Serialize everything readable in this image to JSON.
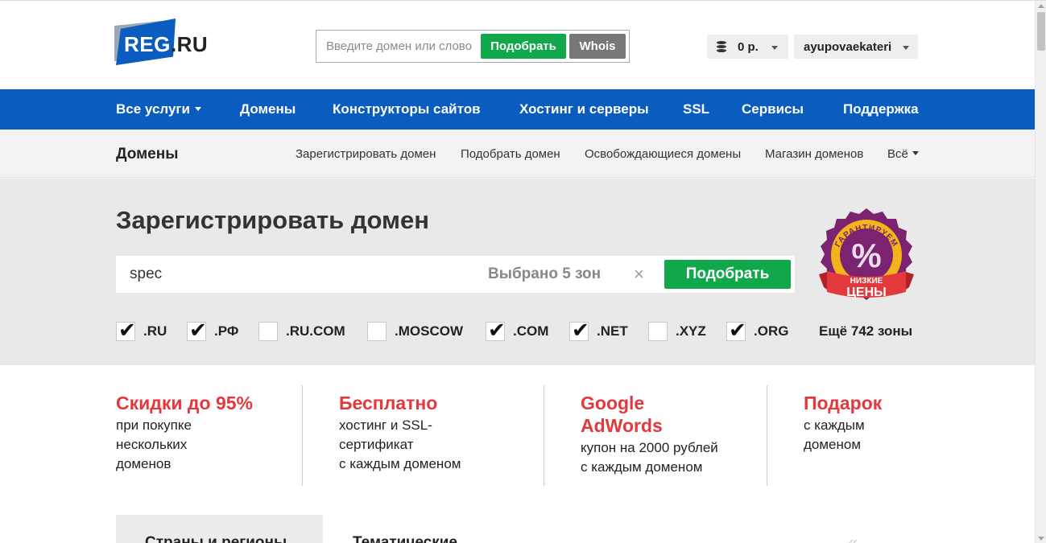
{
  "header": {
    "logo_text": "REG",
    "logo_suffix": ".RU",
    "search_placeholder": "Введите домен или слово",
    "pick_button": "Подобрать",
    "whois_button": "Whois",
    "balance": "0 р.",
    "account_name": "ayupovaekaterina"
  },
  "mainnav": {
    "items": [
      "Все услуги",
      "Домены",
      "Конструкторы сайтов",
      "Хостинг и серверы",
      "SSL",
      "Сервисы",
      "Поддержка"
    ]
  },
  "subnav": {
    "title": "Домены",
    "links": [
      "Зарегистрировать домен",
      "Подобрать домен",
      "Освобождающиеся домены",
      "Магазин доменов",
      "Всё"
    ]
  },
  "hero": {
    "title": "Зарегистрировать домен",
    "input_value": "spec",
    "selected_zones": "Выбрано 5 зон",
    "clear": "×",
    "pick_button": "Подобрать",
    "zones": [
      {
        "label": ".RU",
        "checked": true
      },
      {
        "label": ".РФ",
        "checked": true
      },
      {
        "label": ".RU.COM",
        "checked": false
      },
      {
        "label": ".MOSCOW",
        "checked": false
      },
      {
        "label": ".COM",
        "checked": true
      },
      {
        "label": ".NET",
        "checked": true
      },
      {
        "label": ".XYZ",
        "checked": false
      },
      {
        "label": ".ORG",
        "checked": true
      }
    ],
    "more_zones": "Ещё 742 зоны"
  },
  "badge": {
    "top_text": "ГАРАНТИРУЕМ",
    "symbol": "%",
    "line1": "НИЗКИЕ",
    "line2": "ЦЕНЫ",
    "colors": {
      "outer": "#7b2370",
      "ring": "#f3b31b",
      "ribbon": "#e3393c"
    }
  },
  "promos": [
    {
      "title": "Скидки до 95%",
      "lines": [
        "при покупке",
        "нескольких",
        "доменов"
      ]
    },
    {
      "title": "Бесплатно",
      "lines": [
        "хостинг и SSL-",
        "сертификат",
        "с каждым доменом"
      ]
    },
    {
      "title_lines": [
        "Google",
        "AdWords"
      ],
      "lines": [
        "купон на 2000 рублей",
        "с каждым доменом"
      ]
    },
    {
      "title": "Подарок",
      "lines": [
        "с каждым",
        "доменом"
      ]
    }
  ],
  "bottom": {
    "tab1": "Страны и регионы",
    "tab2": "Тематические"
  },
  "colors": {
    "brand_blue": "#0a5dbe",
    "green": "#11a84b",
    "promo_red": "#e3393c"
  }
}
